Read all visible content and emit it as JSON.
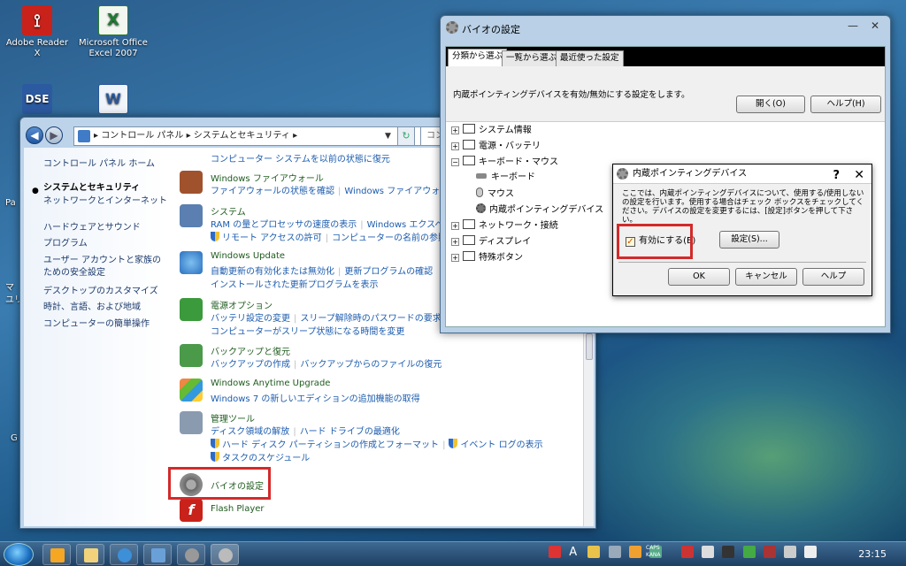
{
  "desktop": {
    "icons": [
      {
        "label_line1": "Adobe Reader X",
        "label_line2": ""
      },
      {
        "label_line1": "Microsoft Office",
        "label_line2": "Excel 2007"
      },
      {
        "label_line1": "",
        "label_line2": ""
      },
      {
        "label_line1": "",
        "label_line2": ""
      }
    ],
    "edge_fragments": [
      "Pa",
      "マ",
      "ユリ",
      "G"
    ]
  },
  "control_panel": {
    "address": [
      "コントロール パネル",
      "システムとセキュリティ"
    ],
    "search_placeholder": "コン",
    "sidebar": {
      "home": "コントロール パネル ホーム",
      "items": [
        "システムとセキュリティ",
        "ネットワークとインターネット",
        "ハードウェアとサウンド",
        "プログラム",
        "ユーザー アカウントと家族の",
        "ための安全設定",
        "デスクトップのカスタマイズ",
        "時計、言語、および地域",
        "コンピューターの簡単操作"
      ]
    },
    "top_link": "コンピューター システムを以前の状態に復元",
    "categories": [
      {
        "title": "Windows ファイアウォール",
        "links": [
          "ファイアウォールの状態を確認",
          "Windows ファイアウォー"
        ]
      },
      {
        "title": "システム",
        "links": [
          "RAM の量とプロセッサの速度の表示",
          "Windows エクスペ"
        ],
        "links2": [
          "リモート アクセスの許可",
          "コンピューターの名前の参照"
        ]
      },
      {
        "title": "Windows Update",
        "links": [
          "自動更新の有効化または無効化",
          "更新プログラムの確認"
        ],
        "links2": [
          "インストールされた更新プログラムを表示"
        ]
      },
      {
        "title": "電源オプション",
        "links": [
          "バッテリ設定の変更",
          "スリープ解除時のパスワードの要求"
        ],
        "links2": [
          "コンピューターがスリープ状態になる時間を変更"
        ]
      },
      {
        "title": "バックアップと復元",
        "links": [
          "バックアップの作成",
          "バックアップからのファイルの復元"
        ]
      },
      {
        "title": "Windows Anytime Upgrade",
        "links": [
          "Windows 7 の新しいエディションの追加機能の取得"
        ]
      },
      {
        "title": "管理ツール",
        "links": [
          "ディスク領域の解放",
          "ハード ドライブの最適化"
        ],
        "links2": [
          "ハード ディスク パーティションの作成とフォーマット",
          "イベント ログの表示"
        ],
        "links3": [
          "タスクのスケジュール"
        ]
      },
      {
        "title": "バイオの設定"
      },
      {
        "title": "Flash Player"
      }
    ]
  },
  "bio_window": {
    "title": "バイオの設定",
    "tabs": [
      "分類から選ぶ",
      "一覧から選ぶ",
      "最近使った設定"
    ],
    "description": "内蔵ポインティングデバイスを有効/無効にする設定をします。",
    "open_button": "開く(O)",
    "help_button": "ヘルプ(H)",
    "tree": [
      {
        "label": "システム情報",
        "level": 0,
        "expander": "+"
      },
      {
        "label": "電源・バッテリ",
        "level": 0,
        "expander": "+"
      },
      {
        "label": "キーボード・マウス",
        "level": 0,
        "expander": "-"
      },
      {
        "label": "キーボード",
        "level": 1
      },
      {
        "label": "マウス",
        "level": 1
      },
      {
        "label": "内蔵ポインティングデバイス",
        "level": 1
      },
      {
        "label": "ネットワーク・接続",
        "level": 0,
        "expander": "+"
      },
      {
        "label": "ディスプレイ",
        "level": 0,
        "expander": "+"
      },
      {
        "label": "特殊ボタン",
        "level": 0,
        "expander": "+"
      }
    ]
  },
  "dialog": {
    "title": "内蔵ポインティングデバイス",
    "help_glyph": "?",
    "close_glyph": "✕",
    "description": "ここでは、内蔵ポインティングデバイスについて、使用する/使用しないの設定を行います。使用する場合はチェック ボックスをチェックしてください。デバイスの設定を変更するには、[設定]ボタンを押して下さい。",
    "checkbox_label": "有効にする(E)",
    "checkbox_checked": true,
    "settings_button": "設定(S)...",
    "ok_button": "OK",
    "cancel_button": "キャンセル",
    "help_button": "ヘルプ"
  },
  "taskbar": {
    "caps_line1": "CAPS",
    "caps_line2": "KANA",
    "ime": "A",
    "time": "23:15"
  },
  "colors": {
    "highlight": "#d32a2a",
    "link": "#1c5cae",
    "category_title": "#1e5b1e"
  }
}
